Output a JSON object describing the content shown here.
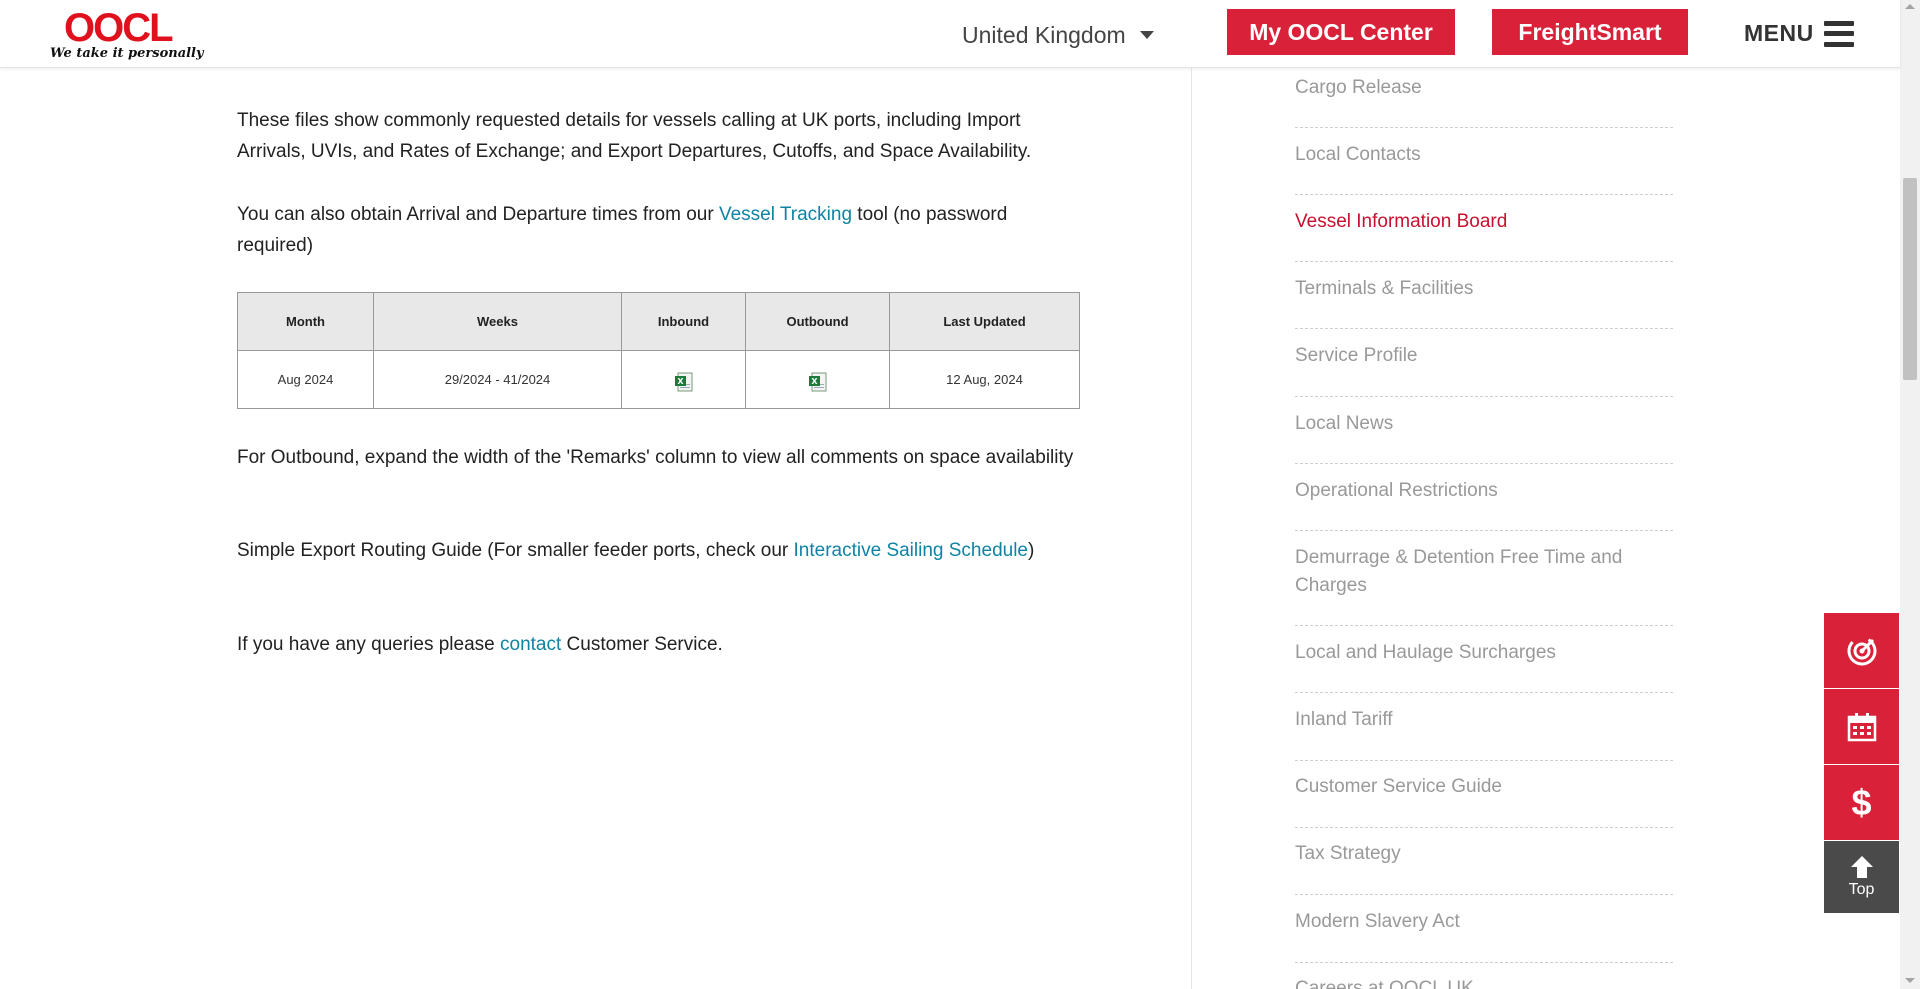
{
  "header": {
    "logo_text": "OOCL",
    "tagline": "We take it personally",
    "country": "United Kingdom",
    "my_center_label": "My OOCL Center",
    "freightsmart_label": "FreightSmart",
    "menu_label": "MENU"
  },
  "main": {
    "p1": "These files show commonly requested details for vessels calling at UK ports, including Import Arrivals, UVIs, and Rates of Exchange; and Export Departures, Cutoffs, and Space Availability.",
    "p2_before": "You can also obtain Arrival and Departure times from our ",
    "p2_link": "Vessel Tracking",
    "p2_after": " tool (no password required)",
    "table": {
      "headers": [
        "Month",
        "Weeks",
        "Inbound",
        "Outbound",
        "Last Updated"
      ],
      "row": {
        "month": "Aug 2024",
        "weeks": "29/2024 - 41/2024",
        "inbound_icon": "excel-file-icon",
        "outbound_icon": "excel-file-icon",
        "last_updated": "12 Aug, 2024"
      }
    },
    "p3": "For Outbound, expand the width of the 'Remarks' column to view all comments on space availability",
    "p4_before": "Simple Export Routing Guide (For smaller feeder ports, check our ",
    "p4_link": "Interactive Sailing Schedule",
    "p4_after": ")",
    "p5_before": "If you have any queries please ",
    "p5_link": "contact",
    "p5_after": " Customer Service."
  },
  "sidebar": {
    "items": [
      {
        "label": "Cargo Release"
      },
      {
        "label": "Local Contacts"
      },
      {
        "label": "Vessel Information Board"
      },
      {
        "label": "Terminals & Facilities"
      },
      {
        "label": "Service Profile"
      },
      {
        "label": "Local News"
      },
      {
        "label": "Operational Restrictions"
      },
      {
        "label": "Demurrage & Detention Free Time and Charges"
      },
      {
        "label": "Local and Haulage Surcharges"
      },
      {
        "label": "Inland Tariff"
      },
      {
        "label": "Customer Service Guide"
      },
      {
        "label": "Tax Strategy"
      },
      {
        "label": "Modern Slavery Act"
      },
      {
        "label": "Careers at OOCL UK"
      }
    ],
    "active_index": 2
  },
  "floating": {
    "tracking_icon": "tracking-icon",
    "schedule_icon": "calendar-icon",
    "price_symbol": "$",
    "top_label": "Top"
  },
  "colors": {
    "brand_red": "#d9223a",
    "link_blue": "#0f83a4",
    "active_red": "#c8102e",
    "sidebar_gray": "#999999"
  }
}
